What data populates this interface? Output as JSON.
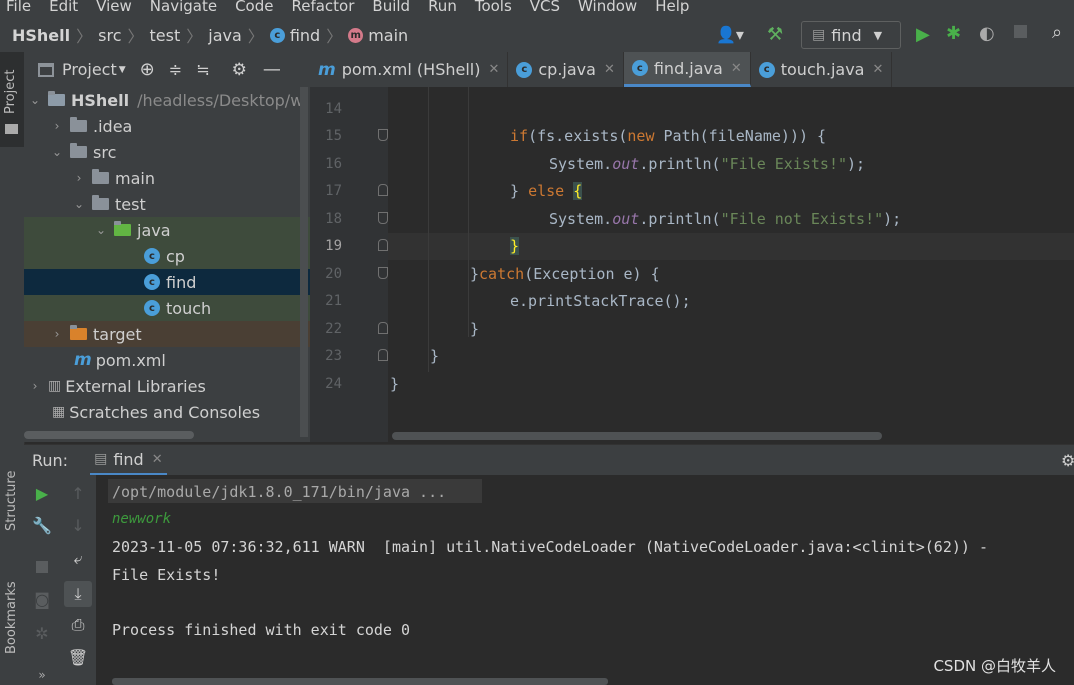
{
  "menu": [
    "File",
    "Edit",
    "View",
    "Navigate",
    "Code",
    "Refactor",
    "Build",
    "Run",
    "Tools",
    "VCS",
    "Window",
    "Help"
  ],
  "breadcrumbs": [
    "HShell",
    "src",
    "test",
    "java",
    "find",
    "main"
  ],
  "run_config": "find",
  "left_strip": {
    "project": "Project",
    "structure": "Structure",
    "bookmarks": "Bookmarks"
  },
  "project_panel": {
    "title": "Project",
    "tree": [
      {
        "label": "HShell",
        "path": "/headless/Desktop/w"
      },
      {
        "label": ".idea"
      },
      {
        "label": "src"
      },
      {
        "label": "main"
      },
      {
        "label": "test"
      },
      {
        "label": "java"
      },
      {
        "label": "cp"
      },
      {
        "label": "find"
      },
      {
        "label": "touch"
      },
      {
        "label": "target"
      },
      {
        "label": "pom.xml"
      },
      {
        "label": "External Libraries"
      },
      {
        "label": "Scratches and Consoles"
      }
    ]
  },
  "editor_tabs": [
    {
      "label": "pom.xml (HShell)"
    },
    {
      "label": "cp.java"
    },
    {
      "label": "find.java"
    },
    {
      "label": "touch.java"
    }
  ],
  "line_numbers": [
    "14",
    "15",
    "16",
    "17",
    "18",
    "19",
    "20",
    "21",
    "22",
    "23",
    "24"
  ],
  "code": {
    "l15_if": "if",
    "l15_a": "(fs.exists(",
    "l15_new": "new",
    "l15_b": " Path(fileName))) {",
    "l16_a": "System.",
    "l16_out": "out",
    "l16_b": ".println(",
    "l16_str": "\"File Exists!\"",
    "l16_c": ");",
    "l17_a": "} ",
    "l17_else": "else",
    "l17_sp": " ",
    "l17_brace": "{",
    "l18_a": "System.",
    "l18_out": "out",
    "l18_b": ".println(",
    "l18_str": "\"File not Exists!\"",
    "l18_c": ");",
    "l19_brace": "}",
    "l20_a": "}",
    "l20_catch": "catch",
    "l20_b": "(Exception e) {",
    "l21_a": "e.printStackTrace();",
    "l22_a": "}",
    "l23_a": "}",
    "l24_a": "}"
  },
  "run_panel": {
    "label": "Run:",
    "tab": "find",
    "console": [
      "/opt/module/jdk1.8.0_171/bin/java ...",
      "newwork",
      "2023-11-05 07:36:32,611 WARN  [main] util.NativeCodeLoader (NativeCodeLoader.java:<clinit>(62)) -",
      "File Exists!",
      "Process finished with exit code 0"
    ]
  },
  "watermark": "CSDN @白牧羊人",
  "colors": {
    "accent": "#4a88c7",
    "selection": "#0d293e",
    "test_bg": "#3e4b3c",
    "target_bg": "#4a3f34"
  }
}
